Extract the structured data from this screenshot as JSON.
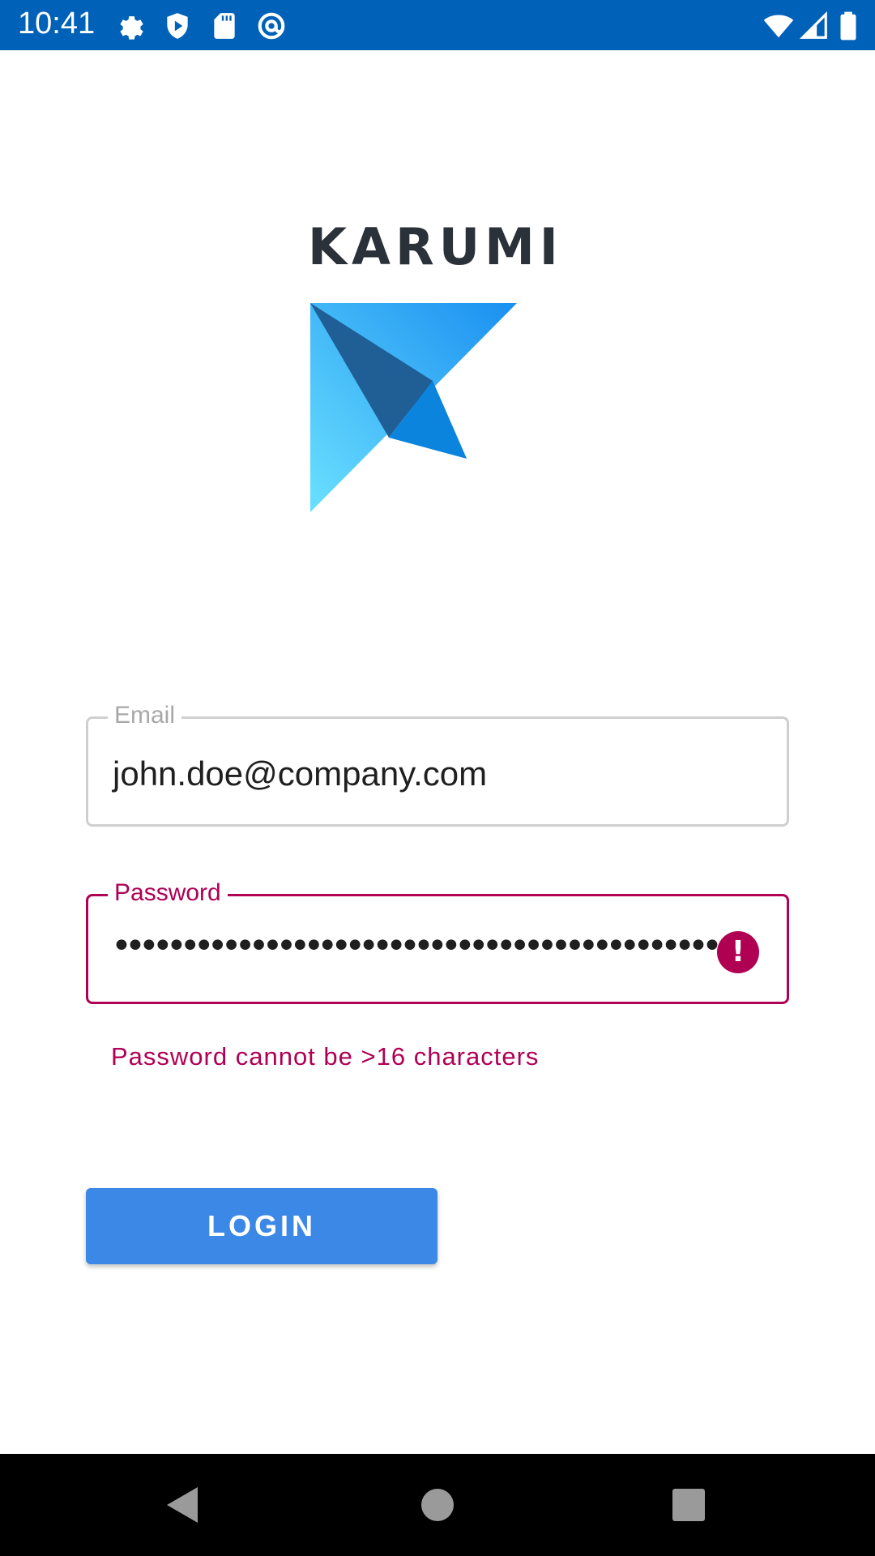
{
  "status_bar": {
    "time": "10:41",
    "left_icons": [
      "settings-icon",
      "shield-icon",
      "sd-card-icon",
      "at-sign-icon"
    ],
    "right_icons": [
      "wifi-icon",
      "signal-icon",
      "battery-icon"
    ]
  },
  "logo": {
    "wordmark": "KARUMI",
    "mark_icon": "paper-plane-logo-icon"
  },
  "form": {
    "email": {
      "label": "Email",
      "value": "john.doe@company.com"
    },
    "password": {
      "label": "Password",
      "masked_value": "•••••••••••••••••••••••••••••••••••••••••••••",
      "error_icon": "!",
      "error_text": "Password cannot be >16 characters"
    },
    "login_button": "LOGIN"
  },
  "colors": {
    "status_bar": "#0061b8",
    "error": "#b00054",
    "button": "#3b88e6",
    "logo_text": "#2b3138"
  },
  "nav_bar": {
    "buttons": [
      "back-icon",
      "home-icon",
      "recents-icon"
    ]
  }
}
